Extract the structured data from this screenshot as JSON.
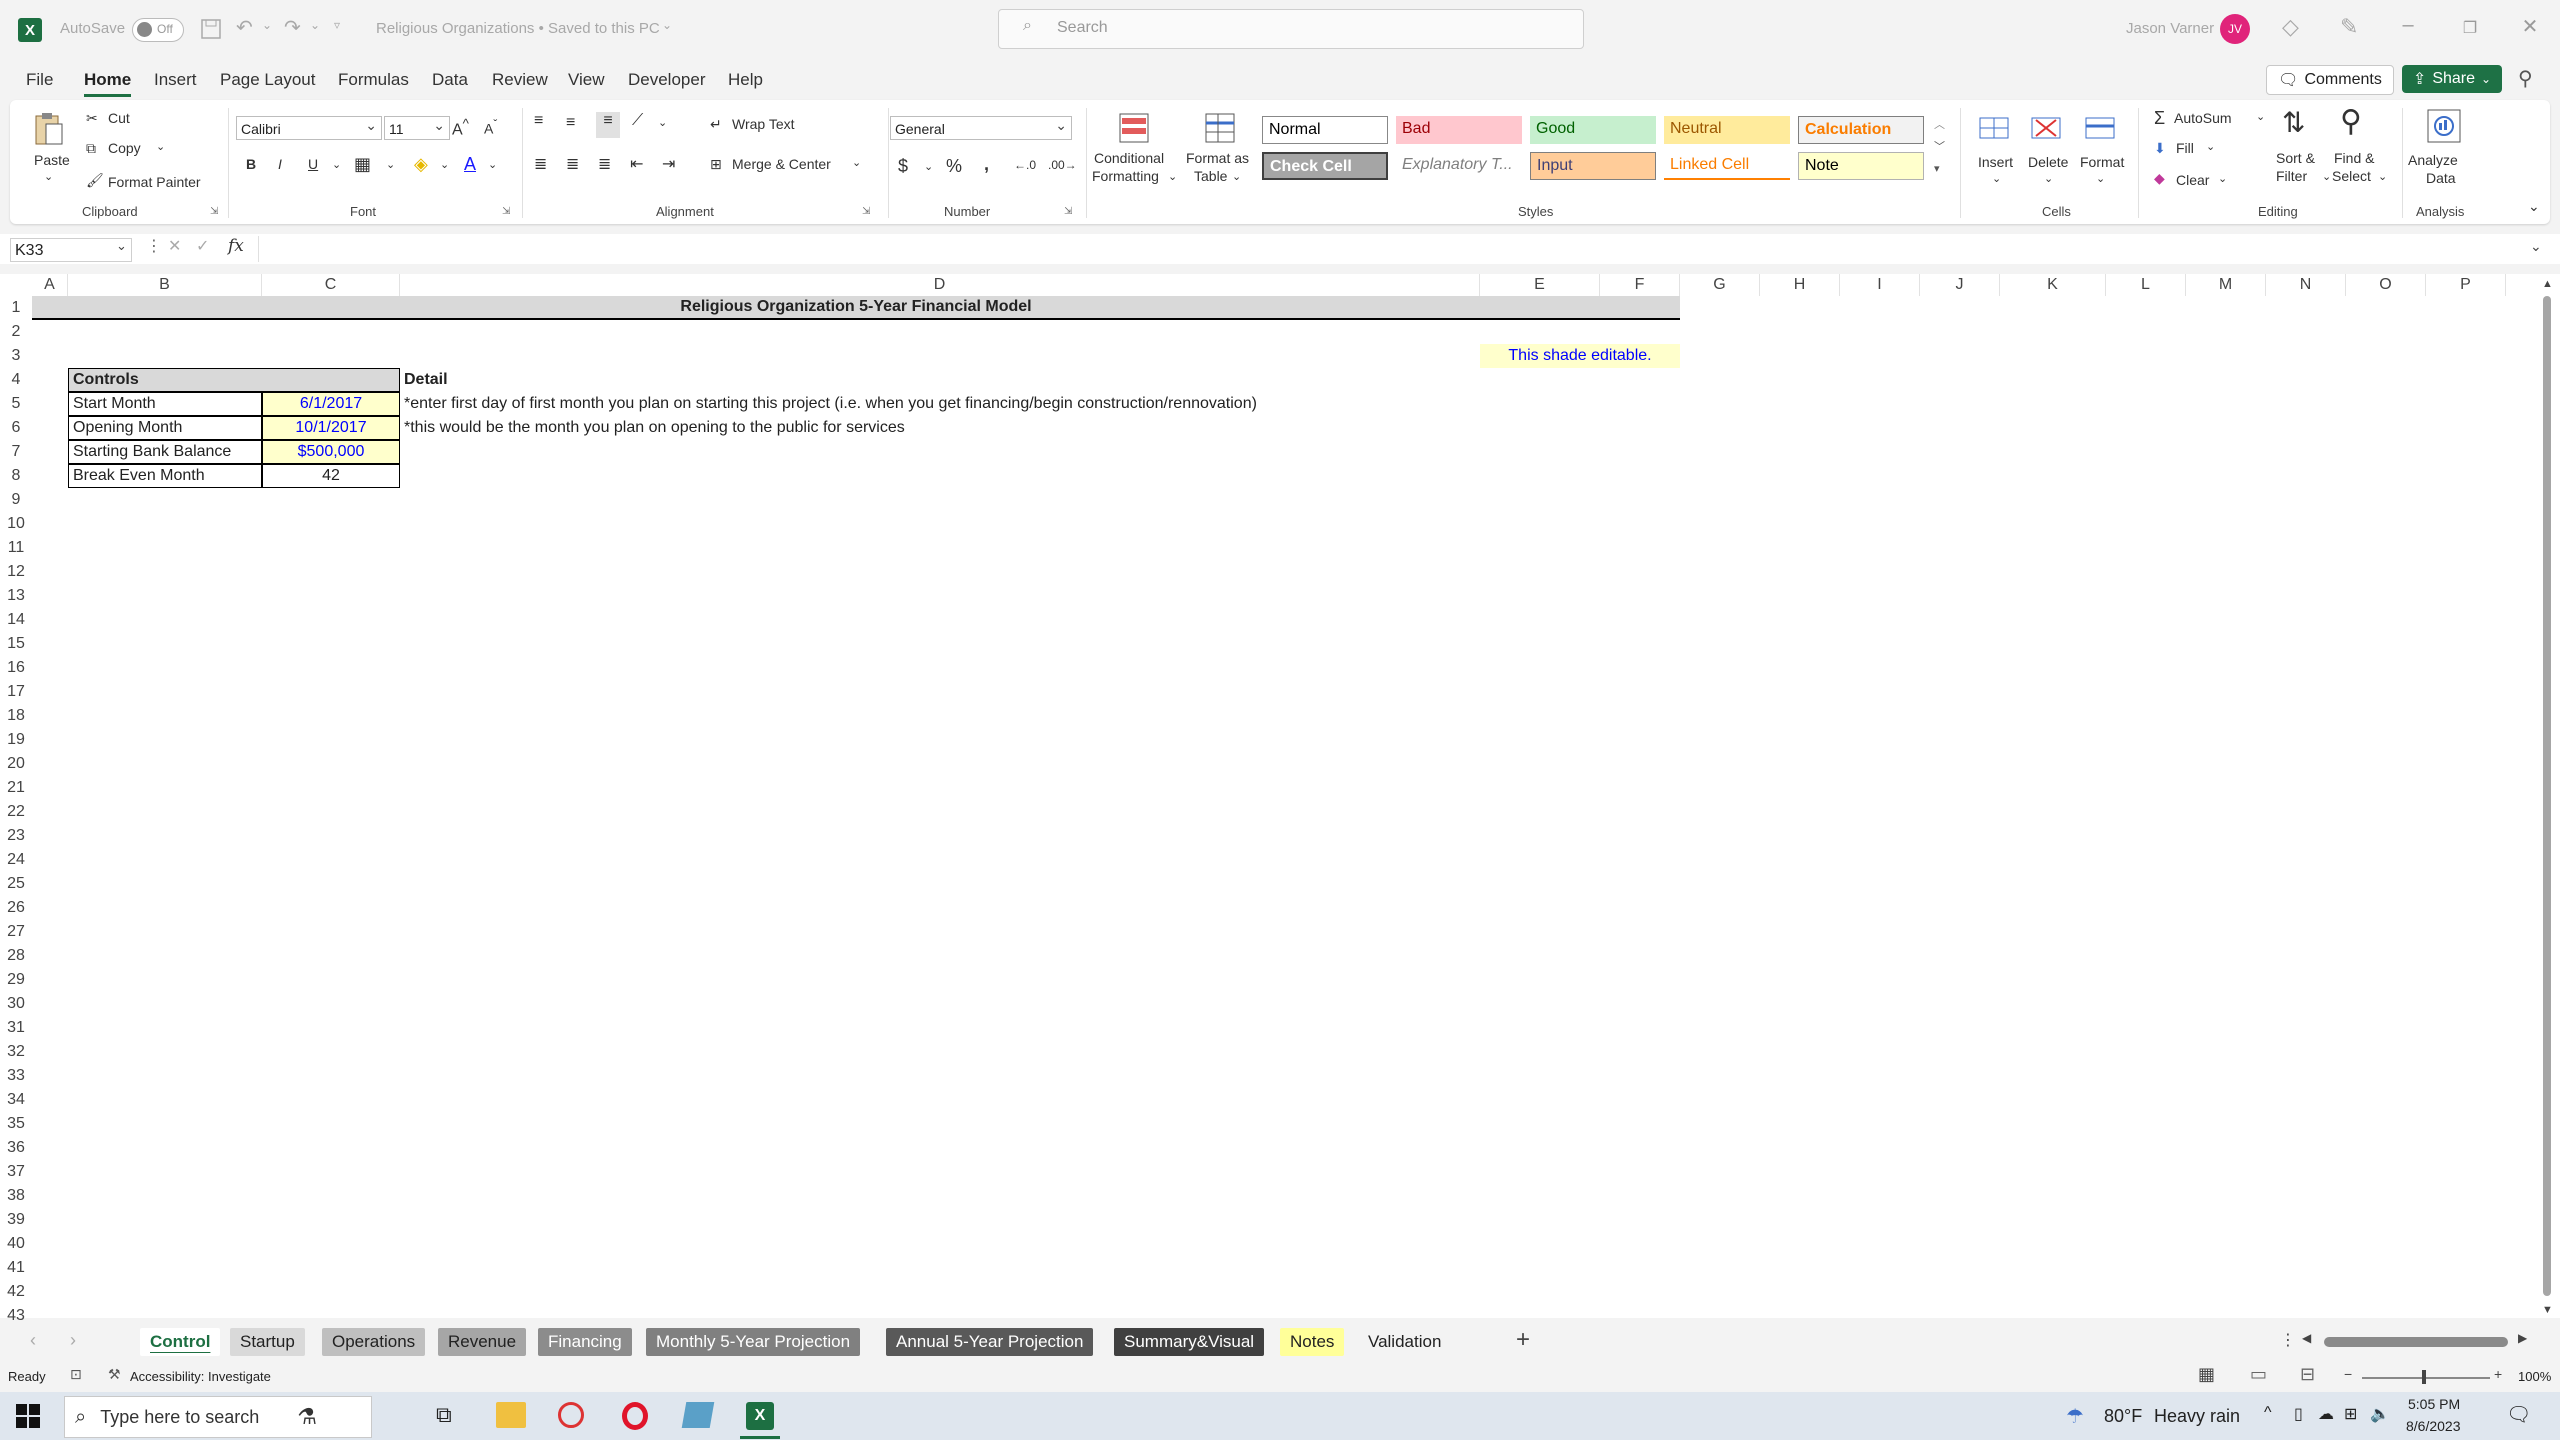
{
  "titlebar": {
    "autosave_label": "AutoSave",
    "autosave_state": "Off",
    "doc_title": "Religious Organizations • Saved to this PC",
    "search_placeholder": "Search",
    "user_name": "Jason Varner",
    "user_initials": "JV"
  },
  "menu": {
    "tabs": [
      "File",
      "Home",
      "Insert",
      "Page Layout",
      "Formulas",
      "Data",
      "Review",
      "View",
      "Developer",
      "Help"
    ],
    "active_tab": "Home",
    "comments_label": "Comments",
    "share_label": "Share"
  },
  "ribbon": {
    "clipboard": {
      "paste": "Paste",
      "cut": "Cut",
      "copy": "Copy",
      "format_painter": "Format Painter",
      "label": "Clipboard"
    },
    "font": {
      "family": "Calibri",
      "size": "11",
      "label": "Font",
      "bold": "B",
      "italic": "I",
      "underline": "U"
    },
    "alignment": {
      "wrap_text": "Wrap Text",
      "merge_center": "Merge & Center",
      "label": "Alignment"
    },
    "number": {
      "format": "General",
      "label": "Number"
    },
    "styles": {
      "conditional_formatting": [
        "Conditional",
        "Formatting"
      ],
      "format_as_table": [
        "Format as",
        "Table"
      ],
      "cells": [
        {
          "label": "Normal",
          "bg": "#ffffff",
          "fg": "#000000"
        },
        {
          "label": "Bad",
          "bg": "#ffc7ce",
          "fg": "#9c0006"
        },
        {
          "label": "Good",
          "bg": "#c6efce",
          "fg": "#006100"
        },
        {
          "label": "Neutral",
          "bg": "#ffeb9c",
          "fg": "#9c5700"
        },
        {
          "label": "Calculation",
          "bg": "#f2f2f2",
          "fg": "#fa7d00"
        },
        {
          "label": "Check Cell",
          "bg": "#a5a5a5",
          "fg": "#ffffff"
        },
        {
          "label": "Explanatory T...",
          "bg": "#ffffff",
          "fg": "#7f7f7f"
        },
        {
          "label": "Input",
          "bg": "#ffcc99",
          "fg": "#3f3f76"
        },
        {
          "label": "Linked Cell",
          "bg": "#ffffff",
          "fg": "#fa7d00"
        },
        {
          "label": "Note",
          "bg": "#ffffcc",
          "fg": "#000000"
        }
      ],
      "label": "Styles"
    },
    "cells": {
      "insert": "Insert",
      "delete": "Delete",
      "format": "Format",
      "label": "Cells"
    },
    "editing": {
      "autosum": "AutoSum",
      "fill": "Fill",
      "clear": "Clear",
      "sort_filter": [
        "Sort &",
        "Filter"
      ],
      "find_select": [
        "Find &",
        "Select"
      ],
      "label": "Editing"
    },
    "analysis": {
      "analyze": [
        "Analyze",
        "Data"
      ],
      "label": "Analysis"
    }
  },
  "formula_bar": {
    "name_box": "K33",
    "fx": "fx",
    "formula": ""
  },
  "columns": [
    "A",
    "B",
    "C",
    "D",
    "E",
    "F",
    "G",
    "H",
    "I",
    "J",
    "K",
    "L",
    "M",
    "N",
    "O",
    "P"
  ],
  "rows": [
    "1",
    "2",
    "3",
    "4",
    "5",
    "6",
    "7",
    "8",
    "9",
    "10",
    "11",
    "12",
    "13",
    "14",
    "15",
    "16",
    "17",
    "18",
    "19",
    "20",
    "21",
    "22",
    "23",
    "24",
    "25",
    "26",
    "27",
    "28",
    "29",
    "30",
    "31",
    "32",
    "33",
    "34",
    "35",
    "36",
    "37",
    "38",
    "39",
    "40",
    "41",
    "42",
    "43"
  ],
  "sheet": {
    "title": "Religious Organization 5-Year Financial Model",
    "editable_note": "This shade editable.",
    "controls_header": "Controls",
    "detail_header": "Detail",
    "controls": [
      {
        "label": "Start Month",
        "value": "6/1/2017",
        "editable": true
      },
      {
        "label": "Opening Month",
        "value": "10/1/2017",
        "editable": true
      },
      {
        "label": "Starting Bank Balance",
        "value": "$500,000",
        "editable": true
      },
      {
        "label": "Break Even Month",
        "value": "42",
        "editable": false
      }
    ],
    "details": [
      "*enter first day of first month you plan on starting this project (i.e. when you get financing/begin construction/rennovation)",
      "*this would be the month you plan on opening to the public for services"
    ]
  },
  "sheet_tabs": [
    {
      "label": "Control",
      "bg": "#ffffff",
      "fg": "#1d6f42",
      "active": true
    },
    {
      "label": "Startup",
      "bg": "#d9d9d9",
      "fg": "#222222"
    },
    {
      "label": "Operations",
      "bg": "#bfbfbf",
      "fg": "#222222"
    },
    {
      "label": "Revenue",
      "bg": "#a6a6a6",
      "fg": "#222222"
    },
    {
      "label": "Financing",
      "bg": "#8c8c8c",
      "fg": "#ffffff"
    },
    {
      "label": "Monthly 5-Year Projection",
      "bg": "#808080",
      "fg": "#ffffff"
    },
    {
      "label": "Annual 5-Year Projection",
      "bg": "#595959",
      "fg": "#ffffff"
    },
    {
      "label": "Summary&Visual",
      "bg": "#404040",
      "fg": "#ffffff"
    },
    {
      "label": "Notes",
      "bg": "#ffff99",
      "fg": "#222222"
    },
    {
      "label": "Validation",
      "bg": "#f3f3f3",
      "fg": "#222222"
    }
  ],
  "status": {
    "ready": "Ready",
    "accessibility": "Accessibility: Investigate",
    "zoom": "100%"
  },
  "taskbar": {
    "search_placeholder": "Type here to search",
    "weather_temp": "80°F",
    "weather_desc": "Heavy rain",
    "time": "5:05 PM",
    "date": "8/6/2023"
  }
}
